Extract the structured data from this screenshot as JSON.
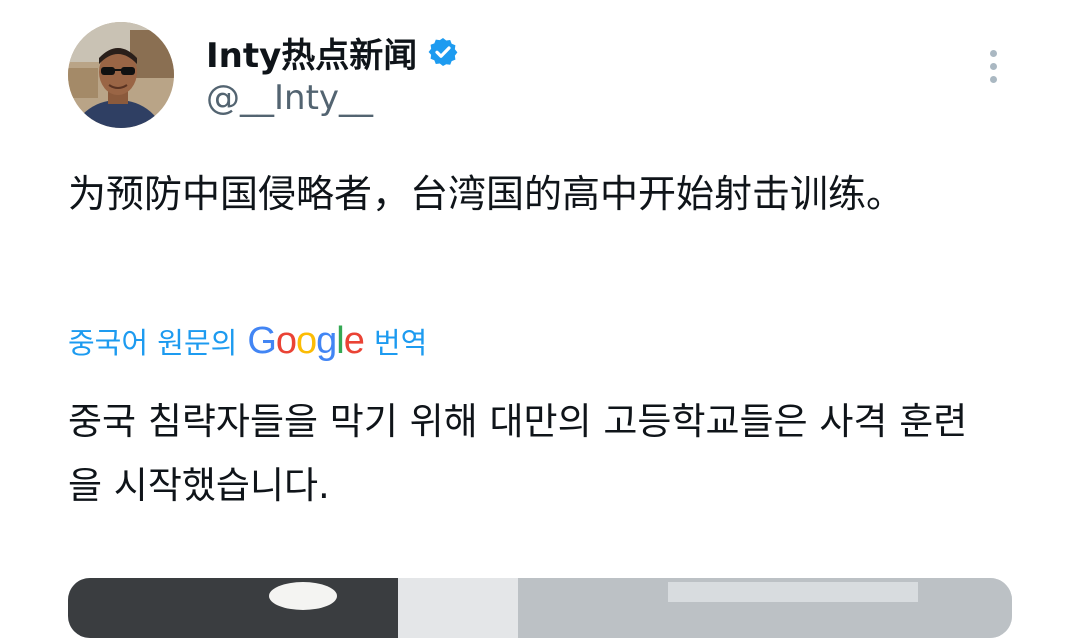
{
  "author": {
    "display_name": "Inty热点新闻",
    "handle": "@__Inty__",
    "verified": true,
    "verified_color": "#1d9bf0",
    "avatar": "avatar-photo"
  },
  "tweet": {
    "text": "为预防中国侵略者，台湾国的高中开始射击训练。"
  },
  "translation": {
    "label": "중국어 원문의",
    "provider_letters": [
      "G",
      "o",
      "o",
      "g",
      "l",
      "e"
    ],
    "provider_colors": [
      "#4285f4",
      "#ea4335",
      "#fbbc05",
      "#4285f4",
      "#34a853",
      "#ea4335"
    ],
    "suffix": "번역",
    "text": "중국 침략자들을 막기 위해 대만의 고등학교들은 사격 훈련을 시작했습니다.",
    "link_color": "#1d9bf0"
  },
  "icons": {
    "more": "more-vertical-icon",
    "verified": "verified-badge-icon"
  }
}
